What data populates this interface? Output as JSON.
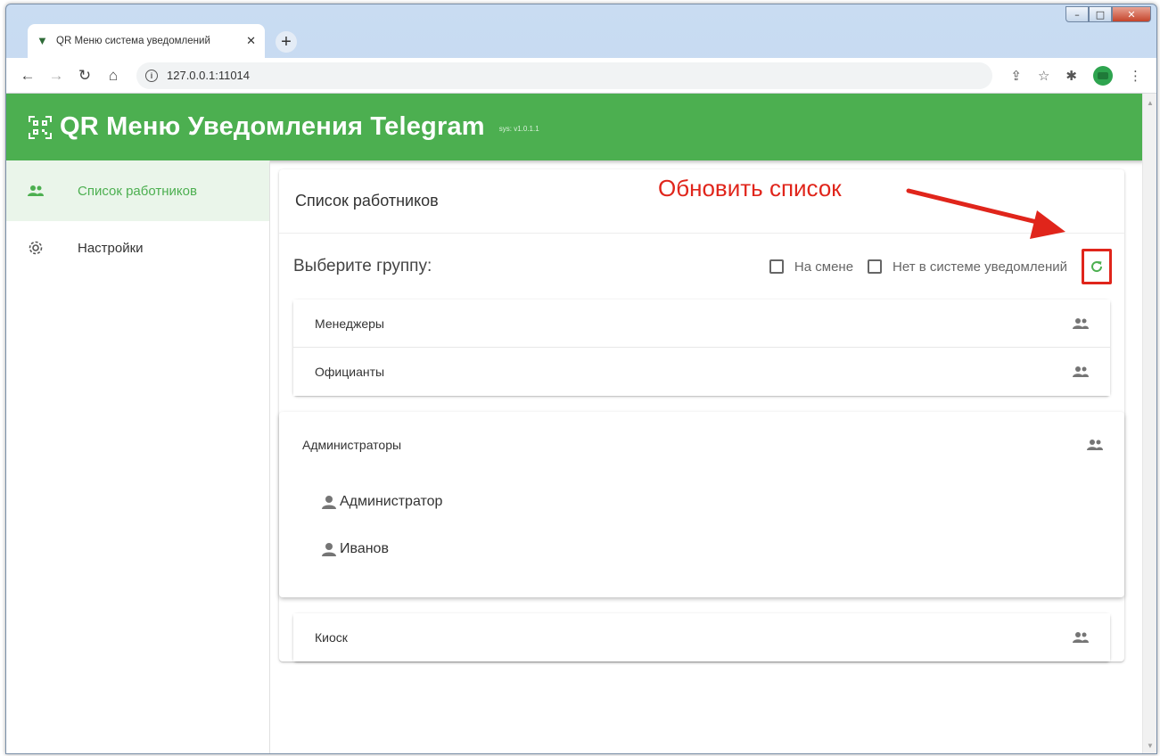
{
  "browser": {
    "tab_title": "QR Меню система уведомлений",
    "tab_close": "✕",
    "new_tab": "+",
    "url": "127.0.0.1:11014",
    "window_controls": {
      "minimize": "–",
      "maximize": "□",
      "close": "✕"
    }
  },
  "app": {
    "title": "QR Меню Уведомления Telegram",
    "version": "sys: v1.0.1.1",
    "accent_color": "#4caf50"
  },
  "sidebar": {
    "items": [
      {
        "label": "Список работников",
        "icon": "people-icon",
        "active": true
      },
      {
        "label": "Настройки",
        "icon": "gear-icon",
        "active": false
      }
    ]
  },
  "main": {
    "card_title": "Список работников",
    "group_label": "Выберите группу:",
    "filters": [
      {
        "label": "На смене",
        "checked": false
      },
      {
        "label": "Нет в системе уведомлений",
        "checked": false
      }
    ],
    "groups_top": [
      {
        "name": "Менеджеры"
      },
      {
        "name": "Официанты"
      }
    ],
    "expanded_group": {
      "name": "Администраторы",
      "users": [
        "Администратор",
        "Иванов"
      ]
    },
    "groups_bottom": [
      {
        "name": "Киоск"
      }
    ]
  },
  "annotation": {
    "text": "Обновить список",
    "color": "#e0251b"
  }
}
